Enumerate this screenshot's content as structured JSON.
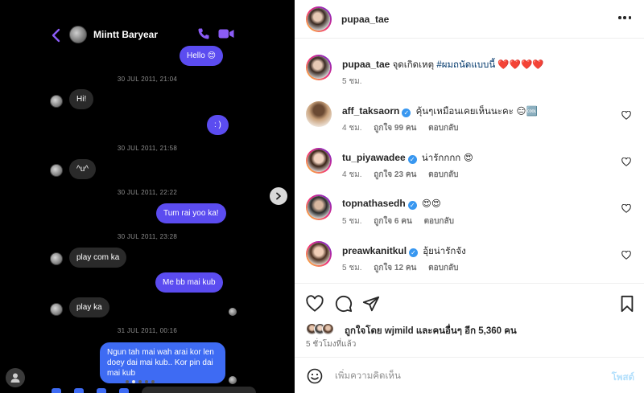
{
  "chat": {
    "contact_name": "Miintt Baryear",
    "messages": [
      {
        "text": "Hello 😊",
        "dir": "out"
      },
      {
        "timestamp": "30 JUL 2011, 21:04"
      },
      {
        "text": "Hi!",
        "dir": "in"
      },
      {
        "text": ": )",
        "dir": "out"
      },
      {
        "timestamp": "30 JUL 2011, 21:58"
      },
      {
        "text": "^u^",
        "dir": "in"
      },
      {
        "timestamp": "30 JUL 2011, 22:22"
      },
      {
        "text": "Tum rai yoo ka!",
        "dir": "out"
      },
      {
        "timestamp": "30 JUL 2011, 23:28"
      },
      {
        "text": "play com ka",
        "dir": "in"
      },
      {
        "text": "Me bb mai kub",
        "dir": "out"
      },
      {
        "text": "play ka",
        "dir": "in"
      },
      {
        "timestamp": "31 JUL 2011, 00:16"
      },
      {
        "text": "Ngun tah mai wah arai kor len doey dai mai kub.. Kor pin dai mai kub",
        "dir": "out"
      }
    ],
    "carousel": {
      "dots": 5,
      "active": 1
    }
  },
  "post": {
    "username": "pupaa_tae",
    "caption": {
      "user": "pupaa_tae",
      "text": "จุดเกิดเหตุ",
      "hashtag": "#ผมถนัดแบบนี้",
      "hearts": "❤️❤️❤️❤️",
      "time": "5 ชม."
    },
    "comments": [
      {
        "user": "aff_taksaorn",
        "verified": true,
        "text": "คุ้นๆเหมือนเคยเห็นนะคะ 😑🆒",
        "time": "4 ชม.",
        "likes": "ถูกใจ 99 คน",
        "reply": "ตอบกลับ"
      },
      {
        "user": "tu_piyawadee",
        "verified": true,
        "text": "น่ารักกกก 😍",
        "time": "4 ชม.",
        "likes": "ถูกใจ 23 คน",
        "reply": "ตอบกลับ"
      },
      {
        "user": "topnathasedh",
        "verified": true,
        "text": "😍😍",
        "time": "5 ชม.",
        "likes": "ถูกใจ 6 คน",
        "reply": "ตอบกลับ"
      },
      {
        "user": "preawkanitkul",
        "verified": true,
        "text": "อุ้ยน่ารักจัง",
        "time": "5 ชม.",
        "likes": "ถูกใจ 12 คน",
        "reply": "ตอบกลับ"
      }
    ],
    "likes_summary": "ถูกใจโดย wjmild และคนอื่นๆ อีก 5,360 คน",
    "posted_ago": "5 ชั่วโมงที่แล้ว",
    "comment_placeholder": "เพิ่มความคิดเห็น",
    "post_button": "โพสต์"
  },
  "colors": {
    "chat_accent": "#8b5cf6",
    "bubble_out": "#5b4cf0",
    "bubble_out_last": "#3e6bf3",
    "bubble_in": "#2a2a2a",
    "ig_link": "#00376b",
    "verified": "#3897f0",
    "post_button": "#b2dffc"
  }
}
